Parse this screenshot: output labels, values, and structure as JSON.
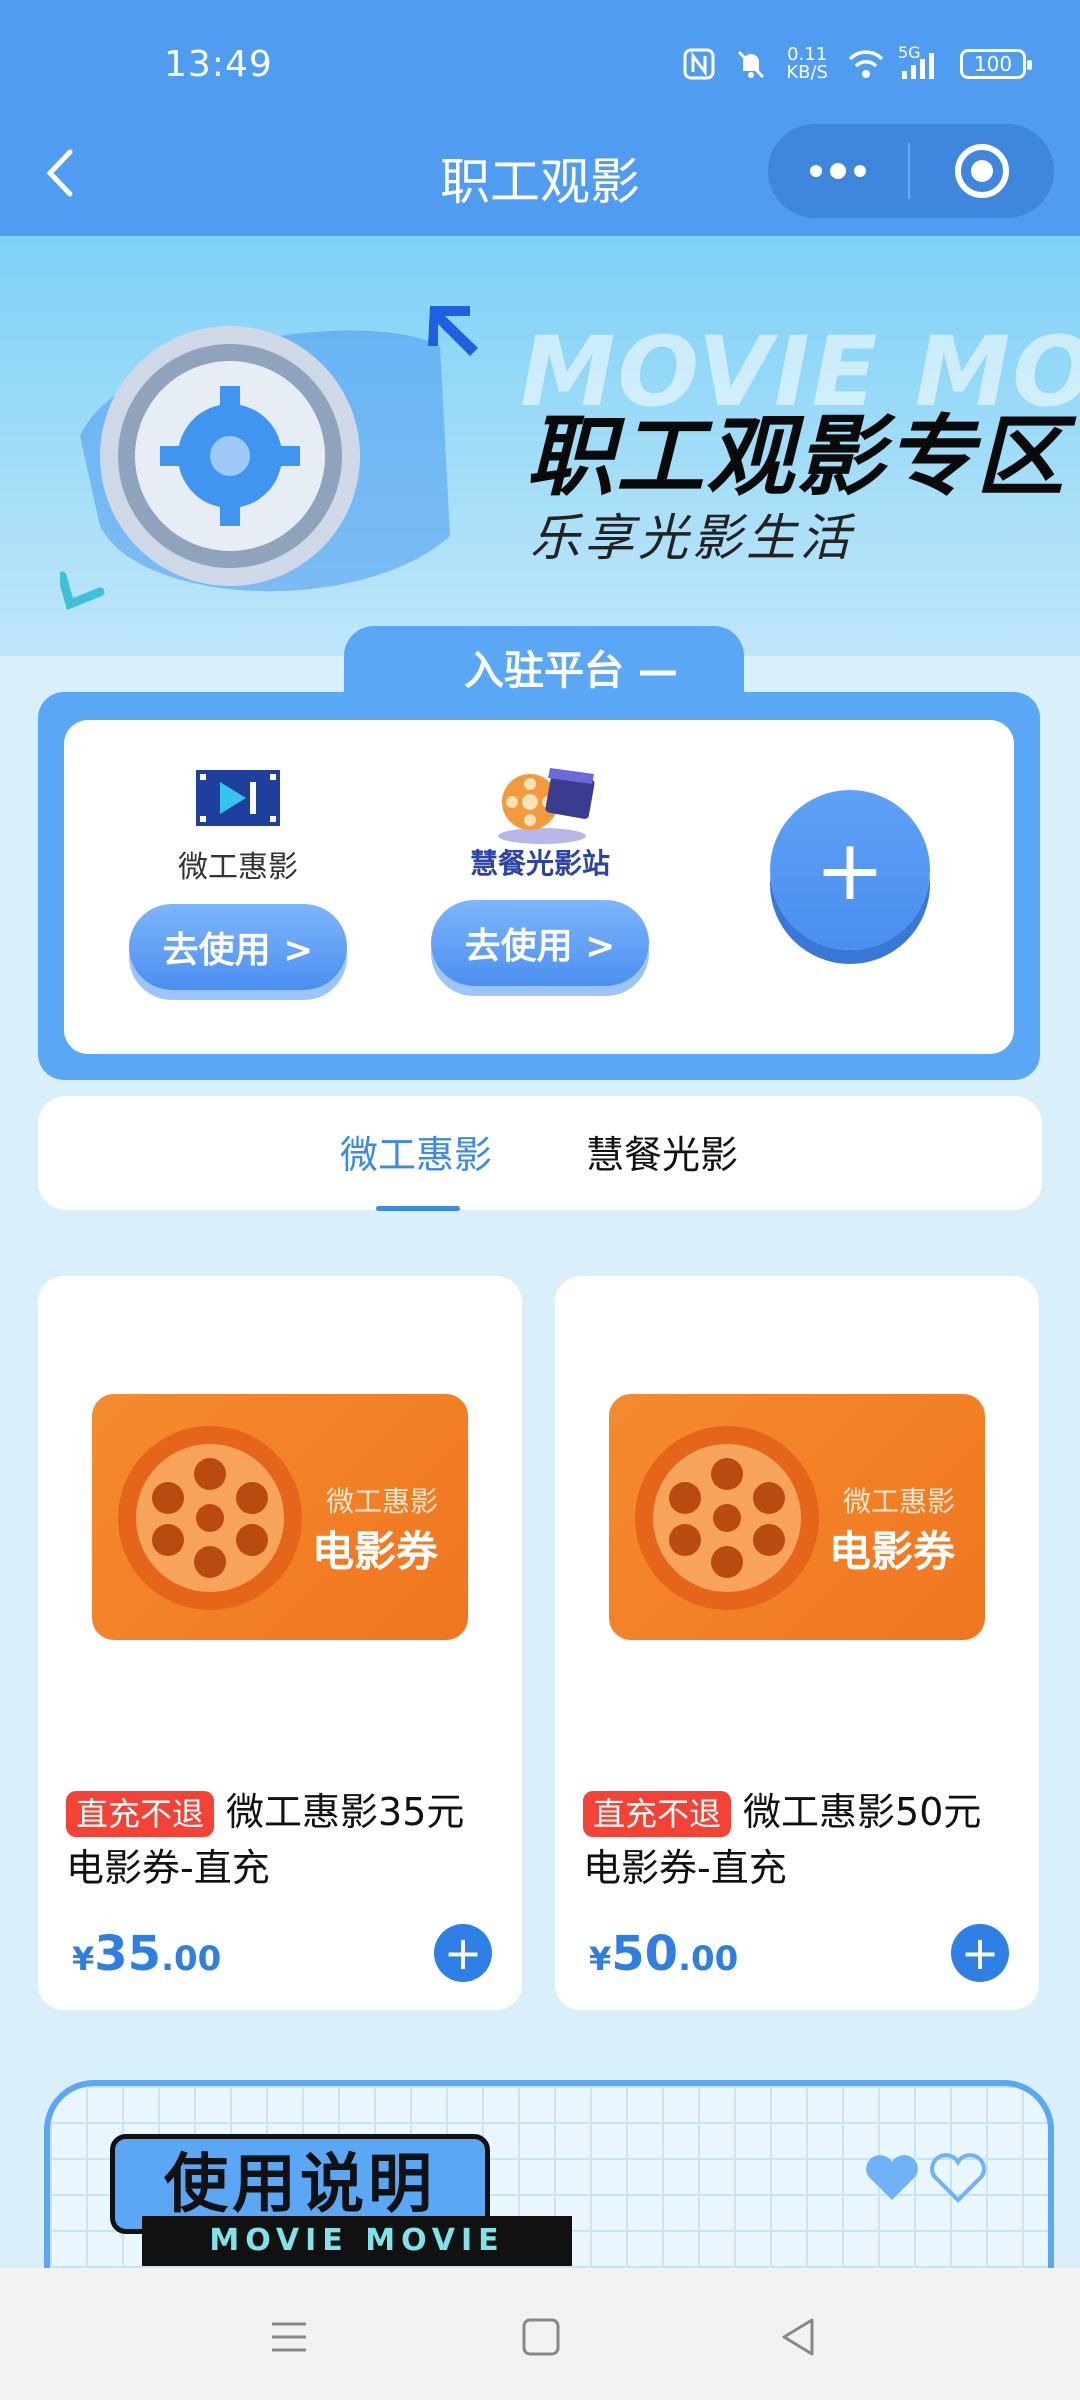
{
  "status_bar": {
    "time": "13:49",
    "net_speed_value": "0.11",
    "net_speed_unit": "KB/S",
    "network": "5G",
    "battery": "100"
  },
  "nav": {
    "title": "职工观影"
  },
  "hero": {
    "bg_text": "MOVIE MOVIE",
    "title": "职工观影专区",
    "subtitle": "乐享光影生活"
  },
  "platforms": {
    "header": "— 入驻平台 —",
    "items": [
      {
        "name": "微工惠影",
        "button": "去使用 >"
      },
      {
        "name": "慧餐光影站",
        "button": "去使用 >"
      }
    ],
    "add_label": "+"
  },
  "tabs": [
    {
      "label": "微工惠影",
      "active": true
    },
    {
      "label": "慧餐光影",
      "active": false
    }
  ],
  "products": [
    {
      "image_brand": "微工惠影",
      "image_kind": "电影券",
      "tag": "直充不退",
      "title": "微工惠影35元电影券-直充",
      "currency": "¥",
      "price_int": "35",
      "price_dec": ".00"
    },
    {
      "image_brand": "微工惠影",
      "image_kind": "电影券",
      "tag": "直充不退",
      "title": "微工惠影50元电影券-直充",
      "currency": "¥",
      "price_int": "50",
      "price_dec": ".00"
    }
  ],
  "usage": {
    "title": "使用说明",
    "subtitle": "MOVIE MOVIE"
  },
  "colors": {
    "primary": "#4f9cf1",
    "accent_blue": "#2f80e4",
    "tag_red": "#f44336",
    "card_orange": "#f58a2e"
  }
}
